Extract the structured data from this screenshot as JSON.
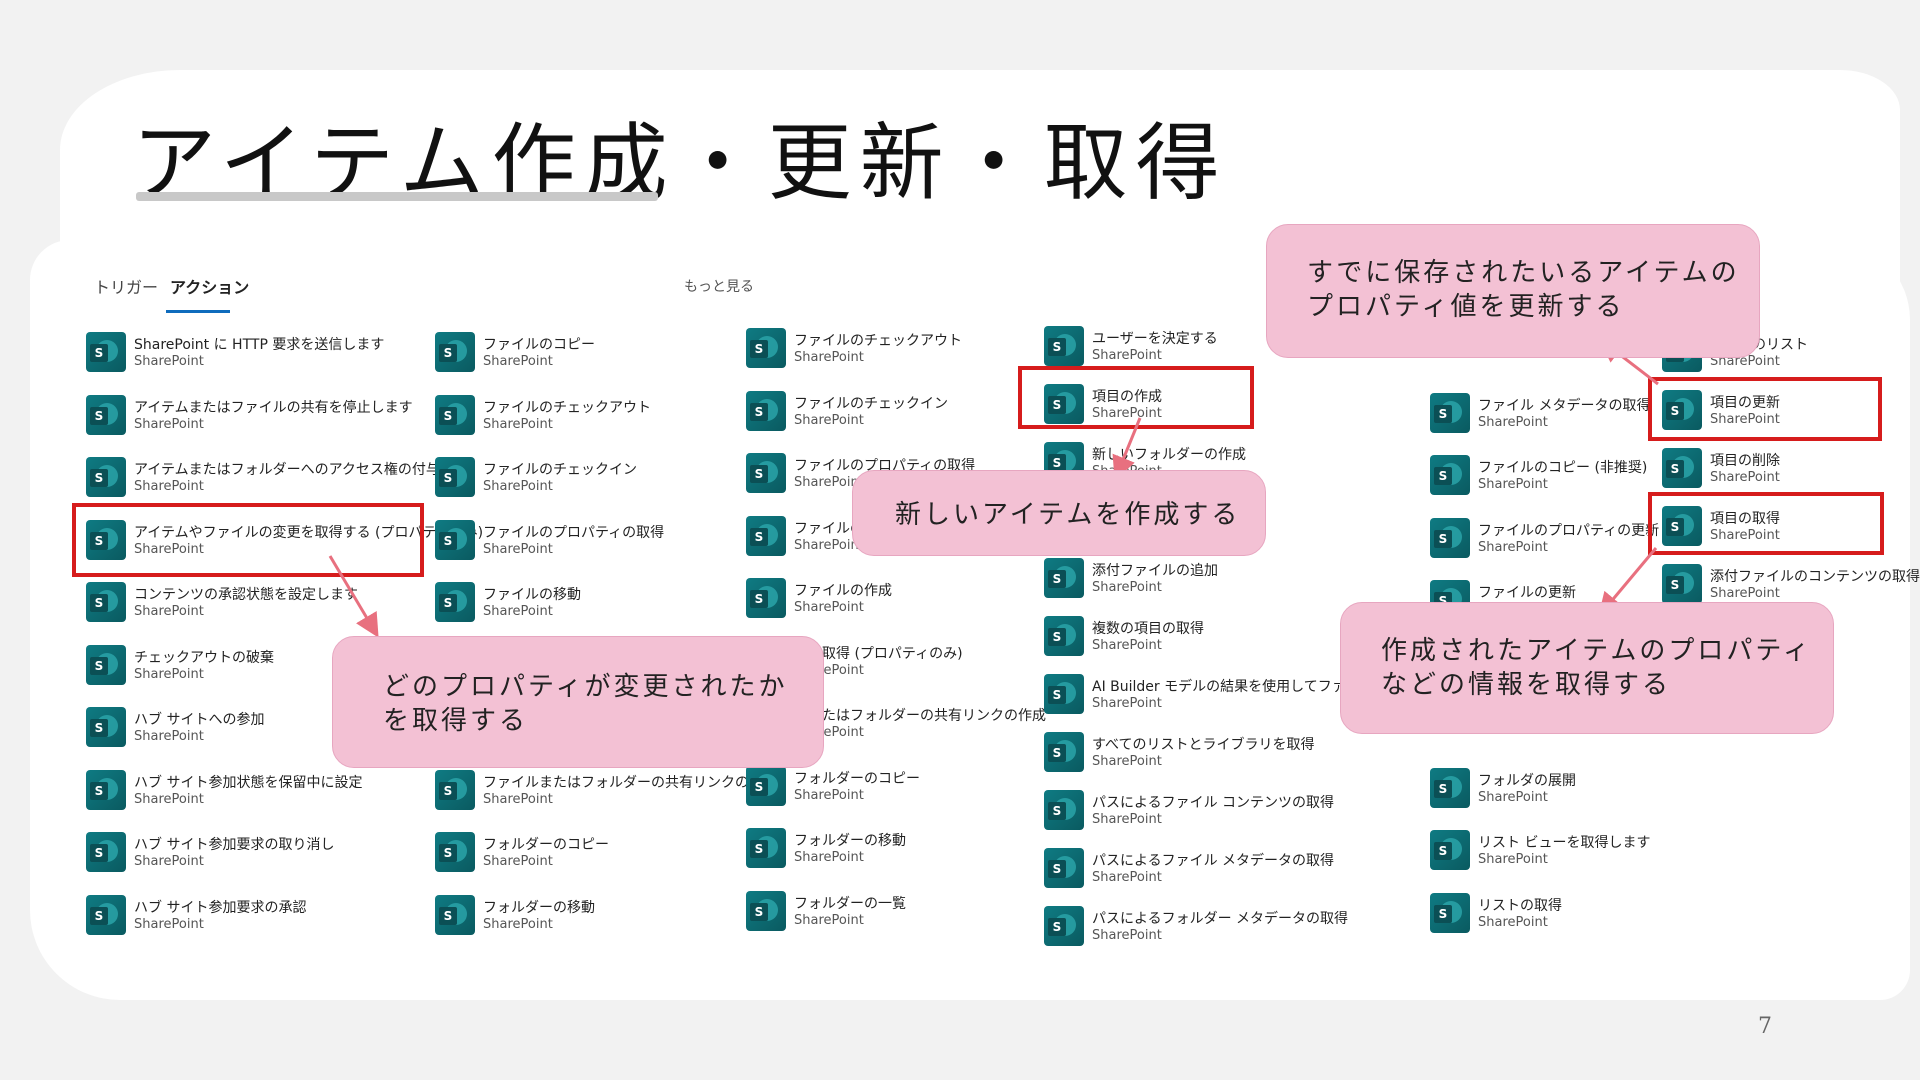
{
  "slide": {
    "title": "アイテム作成・更新・取得",
    "page_number": "7"
  },
  "panel": {
    "tabs": [
      {
        "label": "トリガー"
      },
      {
        "label": "アクション"
      }
    ],
    "more_link": "もっと見る",
    "provider": "SharePoint",
    "columns": [
      [
        "SharePoint に HTTP 要求を送信します",
        "アイテムまたはファイルの共有を停止します",
        "アイテムまたはフォルダーへのアクセス権の付与",
        "アイテムやファイルの変更を取得する (プロパティのみ)",
        "コンテンツの承認状態を設定します",
        "チェックアウトの破棄",
        "ハブ サイトへの参加",
        "ハブ サイト参加状態を保留中に設定",
        "ハブ サイト参加要求の取り消し",
        "ハブ サイト参加要求の承認"
      ],
      [
        "ファイルのコピー",
        "ファイルのチェックアウト",
        "ファイルのチェックイン",
        "ファイルのプロパティの取得",
        "ファイルの移動",
        "",
        "",
        "ファイルまたはフォルダーの共有リンクの作成",
        "フォルダーのコピー",
        "フォルダーの移動"
      ],
      [
        "ファイルのチェックアウト",
        "ファイルのチェックイン",
        "ファイルのプロパティの取得",
        "ファイルの移",
        "ファイルの作成",
        "ルの取得 (プロパティのみ)",
        "ルまたはフォルダーの共有リンクの作成",
        "フォルダーのコピー",
        "フォルダーの移動",
        "フォルダーの一覧"
      ],
      [
        "ユーザーを決定する",
        "項目の作成",
        "新しいフォルダーの作成",
        "",
        "添付ファイルの追加",
        "複数の項目の取得",
        "AI Builder モデルの結果を使用してファイル プロパ",
        "すべてのリストとライブラリを取得",
        "パスによるファイル コンテンツの取得",
        "パスによるファイル メタデータの取得",
        "パスによるフォルダー メタデータの取得"
      ],
      [
        "",
        "ファイル メタデータの取得",
        "ファイルのコピー (非推奨)",
        "ファイルのプロパティの更新",
        "ファイルの更新",
        "",
        "",
        "フォルダの展開",
        "リスト ビューを取得します",
        "リストの取得"
      ],
      [
        "ルダーのリスト",
        "項目の更新",
        "項目の削除",
        "項目の取得",
        "添付ファイルのコンテンツの取得"
      ]
    ]
  },
  "callouts": {
    "update": [
      "すでに保存されたいるアイテムの",
      "プロパティ値を更新する"
    ],
    "create": [
      "新しいアイテムを作成する"
    ],
    "changes": [
      "どのプロパティが変更されたか",
      "を取得する"
    ],
    "get": [
      "作成されたアイテムのプロパティ",
      "などの情報を取得する"
    ]
  },
  "colors": {
    "highlight": "#d61c1c",
    "callout_bg": "#f3c1d4",
    "arrow": "#e8707f",
    "icon": "#0f7b83"
  }
}
